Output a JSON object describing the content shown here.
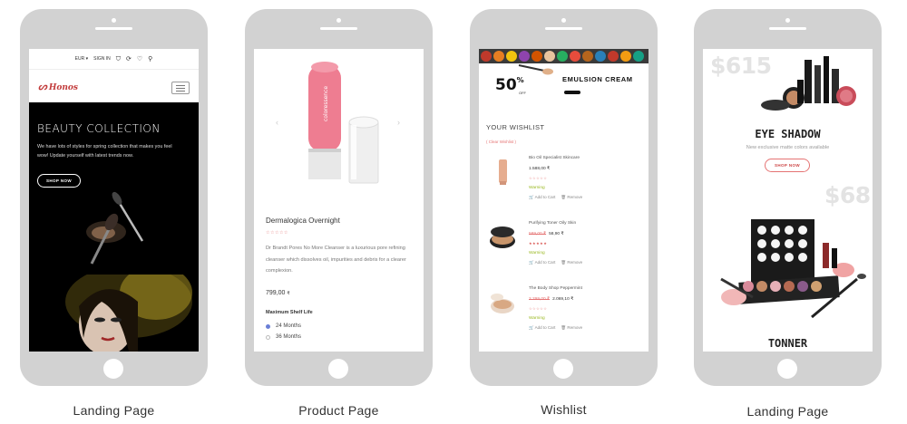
{
  "captions": [
    "Landing Page",
    "Product Page",
    "Wishlist",
    "Landing Page"
  ],
  "landing1": {
    "topbar": {
      "currency": "EUR ▾",
      "signin": "SIGN IN"
    },
    "logo": "Honos",
    "hero": {
      "title": "BEAUTY COLLECTION",
      "text": "We have lots of styles for spring collection that makes you feel wow! Update yourself with latest trends now.",
      "button": "SHOP NOW"
    }
  },
  "product": {
    "name": "Dermalogica Overnight",
    "stars": "☆☆☆☆☆",
    "description": "Dr Brandt Pores No More Cleanser is a luxurious pore refining cleanser which dissolves oil, impurities and debris for a clearer complexion.",
    "price": "799,00",
    "currency": "₹",
    "option_label": "Maximum Shelf Life",
    "options": [
      "24 Months",
      "36 Months"
    ]
  },
  "wishlist": {
    "banner": {
      "discount": "50",
      "percent": "%",
      "off": "OFF",
      "title": "EMULSION CREAM"
    },
    "heading": "YOUR WISHLIST",
    "clear": "( Clear Wishlist )",
    "add_to_cart": "Add to Cart",
    "remove": "Remove",
    "items": [
      {
        "name": "Bio Oil Specialist Skincare",
        "old_price": "",
        "price": "1.588,00 ₹",
        "stars": "☆☆☆☆☆",
        "status": "Warning"
      },
      {
        "name": "Purifying Toner Oily Skin",
        "old_price": "589,00 ₹",
        "price": "58,90 ₹",
        "stars": "★★★★★",
        "status": "Warning"
      },
      {
        "name": "The Body Shop Peppermint",
        "old_price": "2.299,00 ₹",
        "price": "2.069,10 ₹",
        "stars": "☆☆☆☆☆",
        "status": "Warning"
      }
    ]
  },
  "landing2": {
    "price1": "$615",
    "title1": "EYE SHADOW",
    "subtitle1": "New exclusive matte colors available",
    "button1": "SHOP NOW",
    "price2": "$68",
    "title2": "TONNER"
  }
}
